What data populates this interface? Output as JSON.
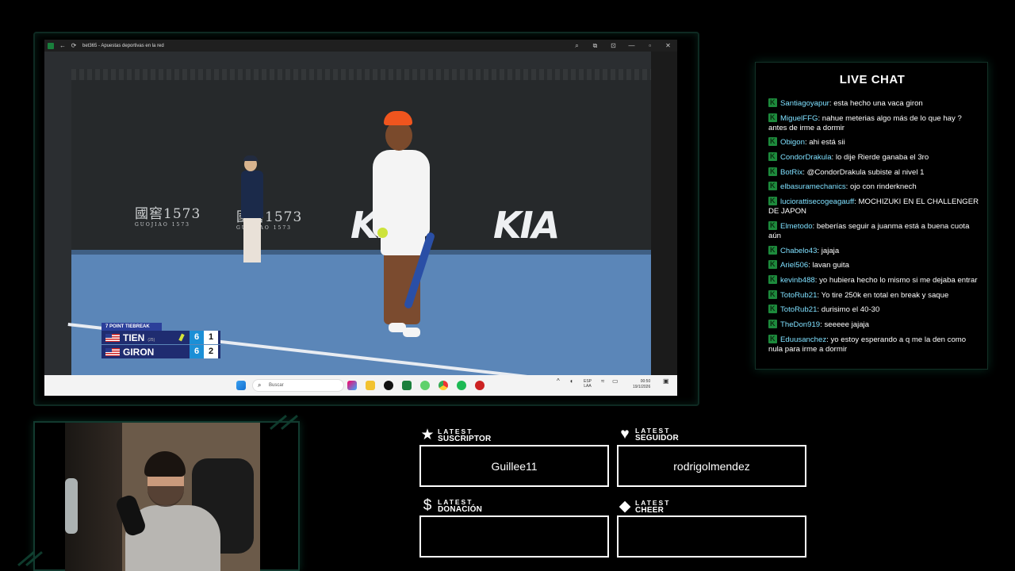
{
  "browser_window": {
    "title": "bet365 - Apuestas deportivas en la red",
    "nav": {
      "back": "←",
      "refresh": "⟳"
    },
    "controls": {
      "zoom": "search-icon",
      "extensions": "extensions-icon",
      "open": "open-icon",
      "minimize": "—",
      "maximize": "▫",
      "close": "✕"
    }
  },
  "video": {
    "sponsor_name": "國窖1573",
    "sponsor_sub": "GUOJIAO 1573",
    "brand": "KIA",
    "scoreboard": {
      "label": "7 POINT TIEBREAK",
      "players": [
        {
          "name": "TIEN",
          "seed": "(25)",
          "set1": "6",
          "set2": "1",
          "serving": true
        },
        {
          "name": "GIRON",
          "seed": "",
          "set1": "6",
          "set2": "2",
          "serving": false
        }
      ]
    }
  },
  "taskbar": {
    "search_placeholder": "Buscar",
    "language": "ESP",
    "language_sub": "LAA",
    "time": "00:50",
    "date": "19/1/2026"
  },
  "chat": {
    "title": "LIVE CHAT",
    "badge_color": "#1d8a3c",
    "username_color": "#7fe0ff",
    "messages": [
      {
        "user": "Santiagoyapur",
        "text": ": esta hecho una vaca giron"
      },
      {
        "user": "MiguelFFG",
        "text": ": nahue meterias algo más de lo que hay ? antes de irme a dormir"
      },
      {
        "user": "Obigon",
        "text": ": ahi está sii"
      },
      {
        "user": "CondorDrakula",
        "text": ": lo dije Rierde ganaba el 3ro"
      },
      {
        "user": "BotRix",
        "text": ": @CondorDrakula subiste al nivel 1"
      },
      {
        "user": "elbasuramechanics",
        "text": ": ojo con rinderknech"
      },
      {
        "user": "luciorattisecogeagauff",
        "text": ": MOCHIZUKI EN EL CHALLENGER DE JAPON"
      },
      {
        "user": "Elmetodo",
        "text": ": beberías seguir a juanma está a buena cuota aún"
      },
      {
        "user": "Chabelo43",
        "text": ": jajaja"
      },
      {
        "user": "Ariel506",
        "text": ": lavan guita"
      },
      {
        "user": "kevinb488",
        "text": ": yo hubiera hecho lo mismo si me dejaba entrar"
      },
      {
        "user": "TotoRub21",
        "text": ": Yo tire 250k en total en break y saque"
      },
      {
        "user": "TotoRub21",
        "text": ": durisimo el 40-30"
      },
      {
        "user": "TheDon919",
        "text": ": seeeee jajaja"
      },
      {
        "user": "Eduusanchez",
        "text": ": yo estoy esperando a q me la den como nula para irme a dormir"
      }
    ]
  },
  "latest": {
    "suscriptor": {
      "line1": "LATEST",
      "line2": "SUSCRIPTOR",
      "value": "Guillee11",
      "icon": "star-icon"
    },
    "seguidor": {
      "line1": "LATEST",
      "line2": "SEGUIDOR",
      "value": "rodrigolmendez",
      "icon": "heart-icon"
    },
    "donacion": {
      "line1": "LATEST",
      "line2": "DONACIÓN",
      "value": "",
      "icon": "dollar-icon"
    },
    "cheer": {
      "line1": "LATEST",
      "line2": "CHEER",
      "value": "",
      "icon": "diamond-icon"
    }
  }
}
